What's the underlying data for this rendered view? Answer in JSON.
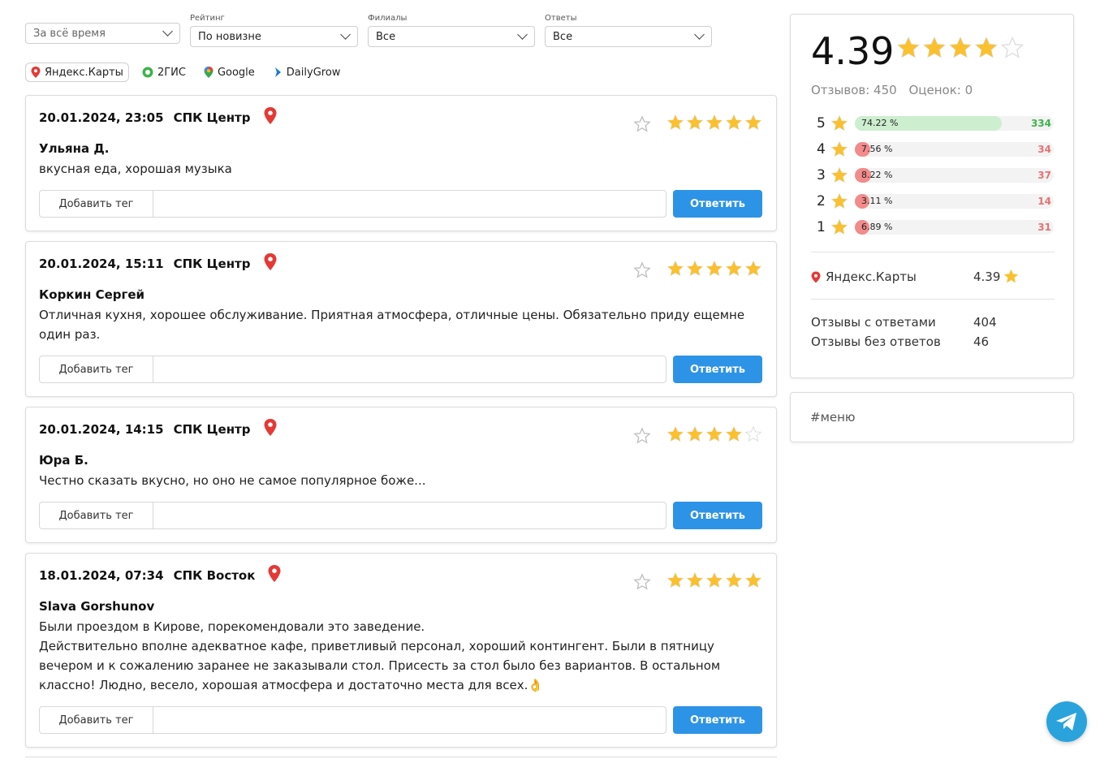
{
  "filters": {
    "period": {
      "label": "",
      "value": "За всё время"
    },
    "rating": {
      "label": "Рейтинг",
      "value": "По новизне"
    },
    "branches": {
      "label": "Филиалы",
      "value": "Все"
    },
    "answers": {
      "label": "Ответы",
      "value": "Все"
    }
  },
  "sources": [
    {
      "label": "Яндекс.Карты",
      "icon": "yandex-pin-icon"
    },
    {
      "label": "2ГИС",
      "icon": "2gis-icon"
    },
    {
      "label": "Google",
      "icon": "google-pin-icon"
    },
    {
      "label": "DailyGrow",
      "icon": "dailygrow-icon"
    }
  ],
  "reviews": [
    {
      "date": "20.01.2024, 23:05",
      "branch": "СПК Центр",
      "author": "Ульяна Д.",
      "stars": 5,
      "text": "вкусная еда, хорошая музыка",
      "tag_label": "Добавить тег",
      "reply_label": "Ответить"
    },
    {
      "date": "20.01.2024, 15:11",
      "branch": "СПК Центр",
      "author": "Коркин Сергей",
      "stars": 5,
      "text": "Отличная кухня, хорошее обслуживание. Приятная атмосфера, отличные цены. Обязательно приду ещемне один раз.",
      "tag_label": "Добавить тег",
      "reply_label": "Ответить"
    },
    {
      "date": "20.01.2024, 14:15",
      "branch": "СПК Центр",
      "author": "Юра Б.",
      "stars": 4,
      "text": "Честно сказать вкусно, но оно не самое популярное боже...",
      "tag_label": "Добавить тег",
      "reply_label": "Ответить"
    },
    {
      "date": "18.01.2024, 07:34",
      "branch": "СПК Восток",
      "author": "Slava Gorshunov",
      "stars": 5,
      "text_line1": "Были проездом в Кирове, порекомендовали это заведение.",
      "text_line2": "Действительно вполне адекватное кафе, приветливый персонал, хороший контингент. Были в пятницу вечером и к сожалению заранее не заказывали стол. Присесть за стол было без вариантов. В остальном классно! Людно, весело, хорошая атмосфера и достаточно места для всех.",
      "emoji": "👌",
      "tag_label": "Добавить тег",
      "reply_label": "Ответить"
    }
  ],
  "summary": {
    "rating": "4.39",
    "rating_value": 4.39,
    "reviews_count": "Отзывов: 450",
    "marks_count": "Оценок: 0",
    "distribution": [
      {
        "stars": "5",
        "pct": "74.22 %",
        "pct_value": 74.22,
        "count": "334",
        "color": "#cdeecf",
        "count_color": "#3fb34f"
      },
      {
        "stars": "4",
        "pct": "7.56 %",
        "pct_value": 7.56,
        "count": "34",
        "color": "#f28b8b",
        "count_color": "#e57373"
      },
      {
        "stars": "3",
        "pct": "8.22 %",
        "pct_value": 8.22,
        "count": "37",
        "color": "#f28b8b",
        "count_color": "#e57373"
      },
      {
        "stars": "2",
        "pct": "3.11 %",
        "pct_value": 3.11,
        "count": "14",
        "color": "#f28b8b",
        "count_color": "#e57373"
      },
      {
        "stars": "1",
        "pct": "6.89 %",
        "pct_value": 6.89,
        "count": "31",
        "color": "#f28b8b",
        "count_color": "#e57373"
      }
    ],
    "source_name": "Яндекс.Карты",
    "source_rating": "4.39",
    "with_answers_label": "Отзывы с ответами",
    "with_answers": "404",
    "without_answers_label": "Отзывы без ответов",
    "without_answers": "46"
  },
  "tag_cloud": {
    "tag": "#меню"
  },
  "colors": {
    "star": "#fbc02d",
    "accent": "#2d93e6",
    "pin": "#e53935",
    "telegram": "#2aa3dc"
  }
}
